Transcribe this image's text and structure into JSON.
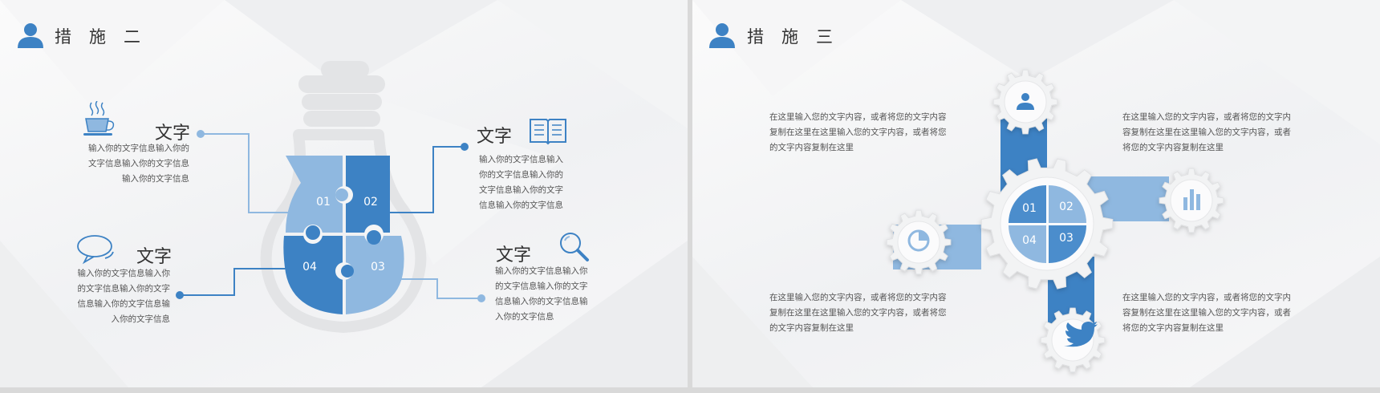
{
  "slides": [
    {
      "title": "措施二",
      "items": [
        {
          "label": "文字",
          "lines": [
            "输入你的文字信息输入你的",
            "文字信息输入你的文字信息",
            "输入你的文字信息"
          ]
        },
        {
          "label": "文字",
          "lines": [
            "输入你的文字信息输入",
            "你的文字信息输入你的",
            "文字信息输入你的文字",
            "信息输入你的文字信息"
          ]
        },
        {
          "label": "文字",
          "lines": [
            "输入你的文字信息输入你",
            "的文字信息输入你的文字",
            "信息输入你的文字信息输",
            "入你的文字信息"
          ]
        },
        {
          "label": "文字",
          "lines": [
            "输入你的文字信息输入你",
            "的文字信息输入你的文字",
            "信息输入你的文字信息输",
            "入你的文字信息"
          ]
        }
      ],
      "pieces": [
        "01",
        "02",
        "04",
        "03"
      ]
    },
    {
      "title": "措施三",
      "texts": [
        [
          "在这里输入您的文字内容，或者将您的文字内容",
          "复制在这里在这里输入您的文字内容，或者将您",
          "的文字内容复制在这里"
        ],
        [
          "在这里输入您的文字内容，或者将您的文字内",
          "容复制在这里在这里输入您的文字内容，或者",
          "将您的文字内容复制在这里"
        ],
        [
          "在这里输入您的文字内容，或者将您的文字内容",
          "复制在这里在这里输入您的文字内容，或者将您",
          "的文字内容复制在这里"
        ],
        [
          "在这里输入您的文字内容，或者将您的文字内",
          "容复制在这里在这里输入您的文字内容，或者",
          "将您的文字内容复制在这里"
        ]
      ],
      "pieces": [
        "01",
        "02",
        "04",
        "03"
      ]
    }
  ],
  "icons": [
    "user-icon",
    "coffee-cup-icon",
    "book-icon",
    "chat-bubble-icon",
    "magnifier-icon",
    "bar-chart-icon",
    "pie-chart-icon",
    "twitter-bird-icon"
  ],
  "colors": {
    "accent": "#3d82c4",
    "light_blue": "#8fb8e0",
    "mid_blue": "#4b8dcc",
    "gray": "#e3e4e6"
  }
}
